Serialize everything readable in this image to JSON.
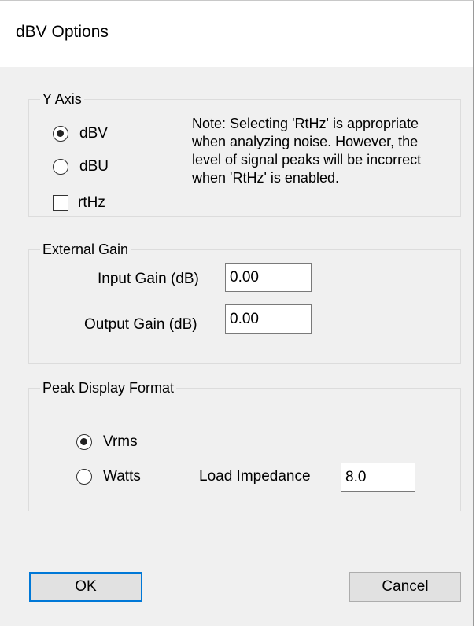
{
  "window": {
    "title": "dBV Options"
  },
  "y_axis": {
    "group_label": "Y Axis",
    "options": [
      {
        "label": "dBV",
        "checked": true
      },
      {
        "label": "dBU",
        "checked": false
      }
    ],
    "rthz": {
      "label": "rtHz",
      "checked": false
    },
    "note": "Note: Selecting 'RtHz' is appropriate when analyzing noise. However, the level of signal peaks will be incorrect when 'RtHz' is enabled."
  },
  "external_gain": {
    "group_label": "External Gain",
    "input_gain_label": "Input Gain (dB)",
    "input_gain_value": "0.00",
    "output_gain_label": "Output Gain (dB)",
    "output_gain_value": "0.00"
  },
  "peak_display": {
    "group_label": "Peak Display Format",
    "options": [
      {
        "label": "Vrms",
        "checked": true
      },
      {
        "label": "Watts",
        "checked": false
      }
    ],
    "load_impedance_label": "Load Impedance",
    "load_impedance_value": "8.0"
  },
  "buttons": {
    "ok_label": "OK",
    "cancel_label": "Cancel"
  },
  "colors": {
    "accent": "#0078d7",
    "dialog_background": "#f0f0f0",
    "titlebar_background": "#ffffff"
  }
}
